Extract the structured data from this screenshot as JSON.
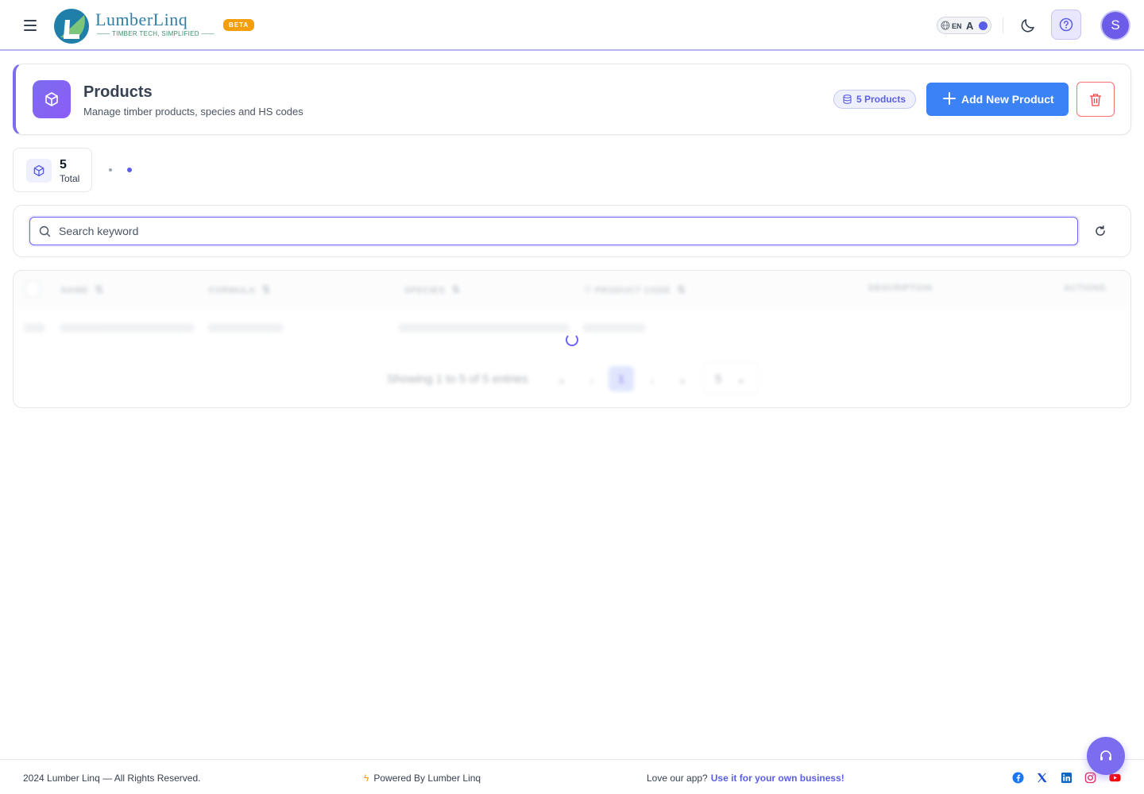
{
  "brand": {
    "name": "LumberLinq",
    "tagline": "TIMBER TECH, SIMPLIFIED",
    "beta": "BETA"
  },
  "header": {
    "lang_en": "EN",
    "lang_ar": "A",
    "avatar_initial": "S",
    "icons": [
      "menu-icon",
      "globe-icon",
      "moon-icon",
      "help-icon"
    ]
  },
  "page": {
    "title": "Products",
    "subtitle": "Manage timber products, species and HS codes",
    "count_badge": "5 Products",
    "add_button": "Add New Product"
  },
  "stats": {
    "total_value": "5",
    "total_label": "Total"
  },
  "search": {
    "placeholder": "Search keyword",
    "value": ""
  },
  "table": {
    "columns": [
      "NAME",
      "FORMULA",
      "SPECIES",
      "PRODUCT CODE",
      "DESCRIPTION",
      "ACTIONS"
    ],
    "pagination": {
      "info": "Showing 1 to 5 of 5 entries",
      "current_page": "1",
      "page_size": "5",
      "first": "«",
      "prev": "‹",
      "next": "›",
      "last": "»"
    }
  },
  "footer": {
    "copyright": "2024 Lumber Linq — All Rights Reserved.",
    "powered": "Powered By Lumber Linq",
    "love": "Love our app?",
    "love_link": "Use it for your own business!",
    "socials": [
      "facebook-icon",
      "x-icon",
      "linkedin-icon",
      "instagram-icon",
      "youtube-icon"
    ]
  },
  "colors": {
    "accent": "#7c6cf0",
    "primary_button": "#3b82f6",
    "danger": "#f87171",
    "beta": "#f59e0b"
  }
}
